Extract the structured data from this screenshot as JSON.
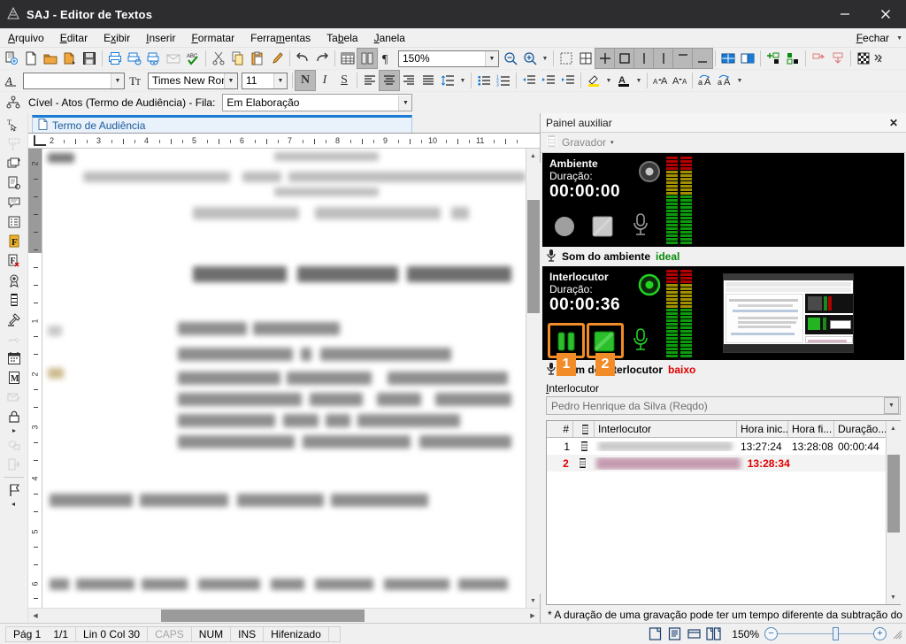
{
  "window": {
    "title": "SAJ - Editor de Textos",
    "app_icon": "saj-logo-icon",
    "minimize": "–",
    "close": "✕"
  },
  "menubar": {
    "items": [
      {
        "label": "Arquivo",
        "accel": "A"
      },
      {
        "label": "Editar",
        "accel": "E"
      },
      {
        "label": "Exibir",
        "accel": "x"
      },
      {
        "label": "Inserir",
        "accel": "I"
      },
      {
        "label": "Formatar",
        "accel": "F"
      },
      {
        "label": "Ferramentas",
        "accel": "m"
      },
      {
        "label": "Tabela",
        "accel": "b"
      },
      {
        "label": "Janela",
        "accel": "J"
      }
    ],
    "close_doc": "Fechar"
  },
  "toolbar1": {
    "zoom_value": "150%",
    "icons": [
      "new-from-model-icon",
      "new-document-icon",
      "open-folder-icon",
      "open-recent-icon",
      "save-icon",
      "print-icon",
      "print-preview-icon",
      "print-view-icon",
      "send-mail-icon",
      "spellcheck-icon",
      "cut-icon",
      "copy-icon",
      "paste-icon",
      "format-painter-icon",
      "undo-icon",
      "redo-icon",
      "insert-table-icon",
      "columns-icon",
      "show-marks-icon"
    ],
    "zoom_out": "zoom-out-icon",
    "zoom_in": "zoom-in-icon"
  },
  "toolbar1b": {
    "icons": [
      "select-region-icon",
      "table-grid-icon",
      "border-all-icon",
      "border-box-icon",
      "border-left-icon",
      "border-right-icon",
      "border-top-icon",
      "border-bottom-icon",
      "split-cells-icon",
      "merge-cells-icon",
      "insert-field-icon",
      "insert-mark-icon",
      "remove-field-icon",
      "remove-mark-icon",
      "checkerboard-icon",
      "more-chevrons-icon"
    ]
  },
  "toolbar2": {
    "style_value": "",
    "style_placeholder": "",
    "font_value": "Times New Romar",
    "size_value": "11",
    "bold": "N",
    "italic": "I",
    "underline": "S",
    "icons": [
      "style-icon",
      "align-left-icon",
      "align-center-icon",
      "align-right-icon",
      "align-justify-icon",
      "line-spacing-icon",
      "bullet-list-icon",
      "numbered-list-icon",
      "decrease-indent-icon",
      "increase-indent-icon",
      "highlight-color-icon",
      "font-color-icon",
      "increase-font-icon",
      "decrease-font-icon",
      "uppercase-icon",
      "lowercase-icon"
    ]
  },
  "contextbar": {
    "icon": "workflow-icon",
    "label": "Cível - Atos (Termo de Audiência) - Fila:",
    "queue_value": "Em Elaboração"
  },
  "doctab": {
    "icon": "document-icon",
    "label": "Termo de Audiência"
  },
  "ruler": {
    "ticks": [
      "2",
      "3",
      "4",
      "5",
      "6",
      "7",
      "8",
      "9",
      "10",
      "11"
    ],
    "vticks": [
      "2",
      "1",
      "2",
      "3",
      "4",
      "5",
      "6"
    ]
  },
  "vtoolbar": {
    "icons": [
      "text-select-icon",
      "text-insert-icon",
      "duplicate-block-icon",
      "document-properties-icon",
      "comment-icon",
      "list-view-icon",
      "field-f-icon",
      "remove-field-f-icon",
      "seal-icon",
      "film-strip-icon",
      "gavel-icon",
      "signature-disabled-icon",
      "calendar-icon",
      "movimentacao-m-icon",
      "envelope-disabled-icon",
      "lock-icon",
      "lock-more-icon",
      "stamp-disabled-icon",
      "export-disabled-icon",
      "flag-icon",
      "collapse-left-icon"
    ]
  },
  "panel": {
    "title": "Painel auxiliar",
    "close_label": "✕",
    "subbar": {
      "icon": "film-strip-icon",
      "label": "Gravador",
      "caret": "▾"
    },
    "ambiente": {
      "name": "Ambiente",
      "duration_label": "Duração:",
      "duration": "00:00:00",
      "record_icon": "record-stop-disc-icon",
      "buttons": [
        "record-button",
        "stop-button",
        "mic-icon"
      ],
      "status_icon": "mic-icon",
      "status_label": "Som do ambiente",
      "status_quality": "ideal",
      "status_quality_color": "#0a8a0a"
    },
    "interlocutor": {
      "name": "Interlocutor",
      "duration_label": "Duração:",
      "duration": "00:00:36",
      "record_icon": "recording-active-disc-icon",
      "pause_button": "pause-button",
      "stop_button": "stop-button",
      "mic_icon": "mic-icon",
      "thumbnail": "screen-capture-thumbnail",
      "status_icon": "mic-icon",
      "status_label": "Som do interlocutor",
      "status_quality": "baixo",
      "status_quality_color": "#e00000",
      "field_label": "Interlocutor",
      "field_value": "Pedro Henrique da Silva (Reqdo)"
    },
    "annotations": [
      {
        "number": "1",
        "target": "pause-button"
      },
      {
        "number": "2",
        "target": "stop-button"
      }
    ],
    "grid": {
      "columns": [
        "#",
        "",
        "Interlocutor",
        "Hora inic...",
        "Hora fi...",
        "Duração..."
      ],
      "rows": [
        {
          "num": "1",
          "icon": "film-strip-icon",
          "interlocutor": "",
          "hora_inicio": "13:27:24",
          "hora_fim": "13:28:08",
          "duracao": "00:00:44",
          "selected": false
        },
        {
          "num": "2",
          "icon": "film-strip-icon",
          "interlocutor": "",
          "hora_inicio": "13:28:34",
          "hora_fim": "",
          "duracao": "",
          "selected": true
        }
      ]
    },
    "footnote": "* A duração de uma gravação pode ter um tempo diferente da subtração do"
  },
  "statusbar": {
    "page": "Pág 1",
    "pages": "1/1",
    "line_col": "Lin 0  Col 30",
    "caps": "CAPS",
    "num": "NUM",
    "ins": "INS",
    "hyphen": "Hifenizado",
    "view_icons": [
      "print-layout-icon",
      "reading-layout-icon",
      "web-layout-icon",
      "two-page-icon"
    ],
    "zoom": "150%",
    "zoom_out": "−",
    "zoom_in": "+"
  }
}
